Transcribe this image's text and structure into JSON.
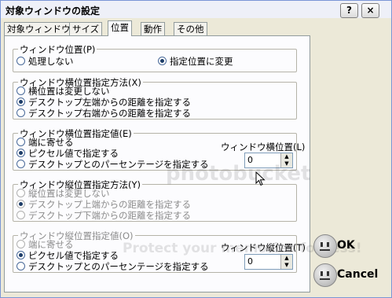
{
  "window": {
    "title": "対象ウィンドウの設定",
    "help_label": "?",
    "close_label": "×"
  },
  "tabs": [
    "対象ウィンドウ",
    "サイズ",
    "位置",
    "動作",
    "その他"
  ],
  "active_tab_index": 2,
  "groups": [
    {
      "label": "ウィンドウ位置(P)",
      "options": [
        "処理しない",
        "指定位置に変更"
      ],
      "selected": 1
    },
    {
      "label": "ウィンドウ横位置指定方法(X)",
      "options": [
        "横位置は変更しない",
        "デスクトップ左端からの距離を指定する",
        "デスクトップ右端からの距離を指定する"
      ],
      "selected": 1
    },
    {
      "label": "ウィンドウ横位置指定値(E)",
      "options": [
        "端に寄せる",
        "ピクセル値で指定する",
        "デスクトップとのパーセンテージを指定する"
      ],
      "selected": 1,
      "spin_label": "ウィンドウ横位置(L)",
      "spin_value": "0"
    },
    {
      "label": "ウィンドウ縦位置指定方法(Y)",
      "options": [
        "縦位置は変更しない",
        "デスクトップ上端からの距離を指定する",
        "デスクトップ下端からの距離を指定する"
      ],
      "selected": 1,
      "disabled": true
    },
    {
      "label": "ウィンドウ縦位置指定値(O)",
      "options": [
        "端に寄せる",
        "ピクセル値で指定する",
        "デスクトップとのパーセンテージを指定する"
      ],
      "selected": 1,
      "spin_label": "ウィンドウ縦位置(T)",
      "spin_value": "0"
    }
  ],
  "buttons": {
    "ok": "OK",
    "cancel": "Cancel"
  },
  "watermark": {
    "line1": "photobucket",
    "line2": "Protect your memories for less!"
  }
}
